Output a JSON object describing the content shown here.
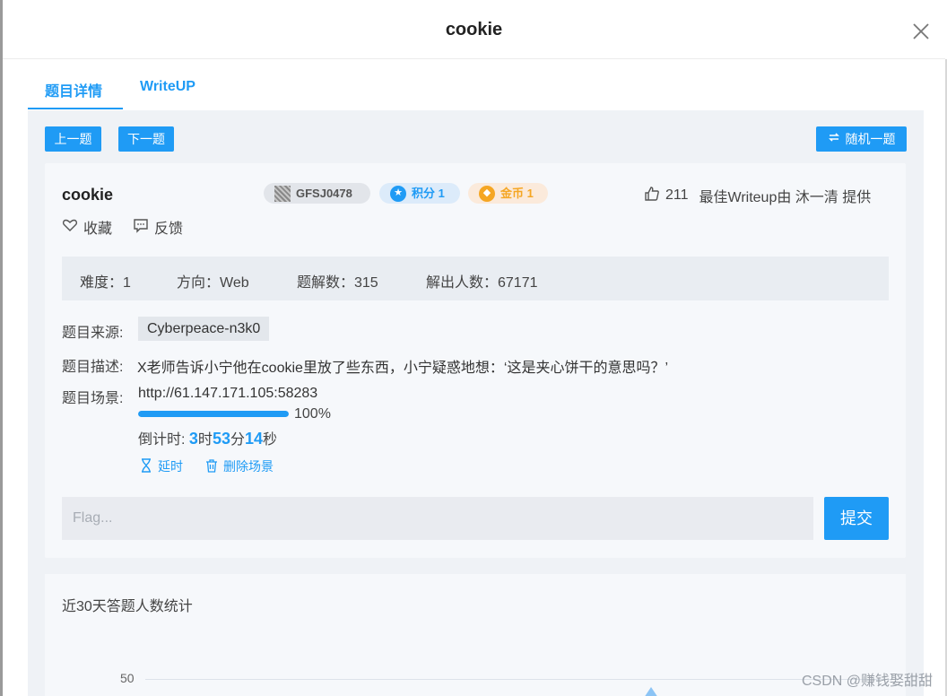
{
  "modal": {
    "title": "cookie"
  },
  "tabs": [
    {
      "label": "题目详情"
    },
    {
      "label": "WriteUP"
    }
  ],
  "nav": {
    "prev": "上一题",
    "next": "下一题",
    "random": "随机一题"
  },
  "challenge": {
    "name": "cookie",
    "badges": {
      "code": "GFSJ0478",
      "score": "积分 1",
      "coin": "金币 1"
    },
    "likes": "211",
    "writeup_credit": "最佳Writeup由 沐一清 提供",
    "actions": {
      "favorite": "收藏",
      "feedback": "反馈"
    },
    "stats": {
      "difficulty": "难度：1",
      "direction": "方向：Web",
      "solutions": "题解数：315",
      "solvers": "解出人数：67171"
    },
    "source_label": "题目来源:",
    "source": "Cyberpeace-n3k0",
    "desc_label": "题目描述:",
    "description": "X老师告诉小宁他在cookie里放了些东西，小宁疑惑地想：‘这是夹心饼干的意思吗？’",
    "scene_label": "题目场景:",
    "scene_url": "http://61.147.171.105:58283",
    "progress_percent": 100,
    "progress_text": "100%",
    "countdown": {
      "label": "倒计时: ",
      "hours": "3",
      "h_unit": "时",
      "minutes": "53",
      "m_unit": "分",
      "seconds": "14",
      "s_unit": "秒"
    },
    "scene_actions": {
      "extend": "延时",
      "delete": "删除场景"
    },
    "flag_placeholder": "Flag...",
    "submit": "提交"
  },
  "stats_chart": {
    "title": "近30天答题人数统计",
    "tick_label": "50"
  },
  "watermark": "CSDN @赚钱娶甜甜"
}
